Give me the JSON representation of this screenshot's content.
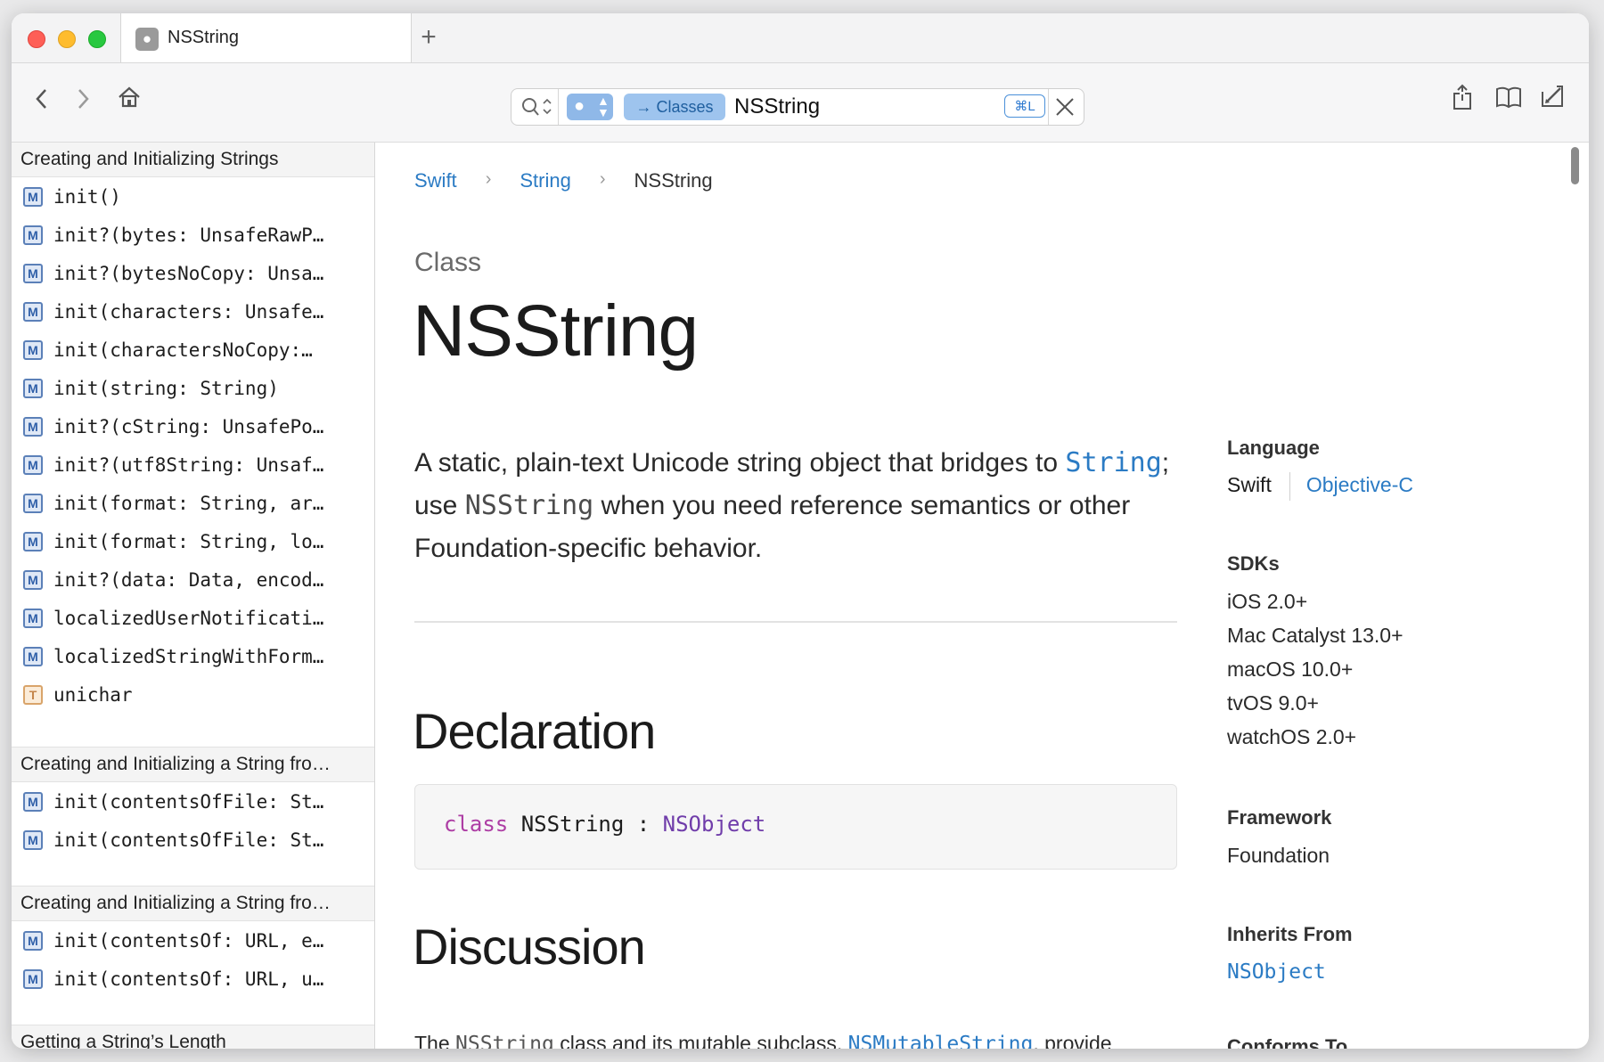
{
  "tab": {
    "title": "NSString",
    "new_tab": "+"
  },
  "toolbar": {
    "search_query": "NSString",
    "scope_token": "→ Classes",
    "shortcut": "⌘L"
  },
  "sidebar": {
    "sections": [
      {
        "title": "Creating and Initializing Strings",
        "items": [
          {
            "badge": "M",
            "label": "init()"
          },
          {
            "badge": "M",
            "label": "init?(bytes: UnsafeRawP…"
          },
          {
            "badge": "M",
            "label": "init?(bytesNoCopy: Unsa…"
          },
          {
            "badge": "M",
            "label": "init(characters: Unsafe…"
          },
          {
            "badge": "M",
            "label": "init(charactersNoCopy:…"
          },
          {
            "badge": "M",
            "label": "init(string: String)"
          },
          {
            "badge": "M",
            "label": "init?(cString: UnsafePo…"
          },
          {
            "badge": "M",
            "label": "init?(utf8String: Unsaf…"
          },
          {
            "badge": "M",
            "label": "init(format: String, ar…"
          },
          {
            "badge": "M",
            "label": "init(format: String, lo…"
          },
          {
            "badge": "M",
            "label": "init?(data: Data, encod…"
          },
          {
            "badge": "M",
            "label": "localizedUserNotificati…"
          },
          {
            "badge": "M",
            "label": "localizedStringWithForm…"
          },
          {
            "badge": "T",
            "label": "unichar"
          }
        ]
      },
      {
        "title": "Creating and Initializing a String fro…",
        "items": [
          {
            "badge": "M",
            "label": "init(contentsOfFile: St…"
          },
          {
            "badge": "M",
            "label": "init(contentsOfFile: St…"
          }
        ]
      },
      {
        "title": "Creating and Initializing a String fro…",
        "items": [
          {
            "badge": "M",
            "label": "init(contentsOf: URL, e…"
          },
          {
            "badge": "M",
            "label": "init(contentsOf: URL, u…"
          }
        ]
      },
      {
        "title": "Getting a String’s Length",
        "items": []
      }
    ]
  },
  "breadcrumb": {
    "items": [
      "Swift",
      "String"
    ],
    "current": "NSString"
  },
  "main": {
    "kind": "Class",
    "title": "NSString",
    "abstract": {
      "p1": "A static, plain-text Unicode string object that bridges to ",
      "link1": "String",
      "p2": "; use ",
      "code1": "NSString",
      "p3": " when you need reference semantics or other Foundation-specific behavior."
    },
    "declaration_heading": "Declaration",
    "declaration": {
      "keyword": "class",
      "name": "NSString",
      "colon": ":",
      "super": "NSObject"
    },
    "discussion_heading": "Discussion",
    "discussion": {
      "p1": "The ",
      "code1": "NSString",
      "p2": " class and its mutable subclass, ",
      "link1": "NSMutableString",
      "p3": ", provide"
    }
  },
  "aside": {
    "language_label": "Language",
    "languages": [
      "Swift",
      "Objective-C"
    ],
    "sdks_label": "SDKs",
    "sdks": [
      "iOS 2.0+",
      "Mac Catalyst 13.0+",
      "macOS 10.0+",
      "tvOS 9.0+",
      "watchOS 2.0+"
    ],
    "framework_label": "Framework",
    "framework": "Foundation",
    "inherits_label": "Inherits From",
    "inherits": "NSObject",
    "conforms_label": "Conforms To"
  },
  "colors": {
    "link": "#2b7bc4",
    "keyword": "#ad3da4",
    "type": "#703daa",
    "badge_m": "#5b80b8",
    "badge_t": "#d9a46a"
  },
  "icons": [
    "back-icon",
    "forward-icon",
    "home-icon",
    "search-icon",
    "apple-icon",
    "share-icon",
    "bookmarks-icon",
    "edit-icon",
    "close-icon"
  ]
}
